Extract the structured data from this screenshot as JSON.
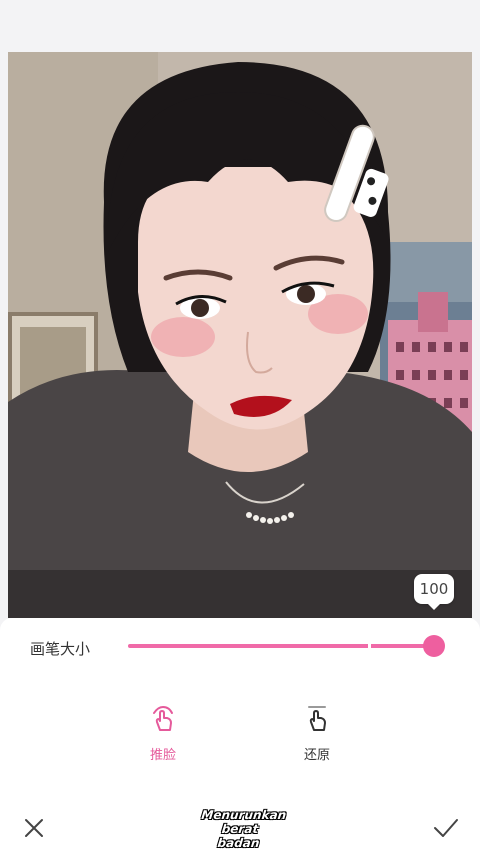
{
  "photo": {
    "brush_size_value": "100"
  },
  "brush": {
    "label": "画笔大小",
    "value": 100,
    "max": 100
  },
  "tools": {
    "push": {
      "label": "推脸",
      "icon": "hand-tap-icon",
      "active": true
    },
    "restore": {
      "label": "还原",
      "icon": "hand-restore-icon",
      "active": false
    }
  },
  "bottom": {
    "cancel_icon": "close-icon",
    "confirm_icon": "checkmark-icon",
    "watermark_line1": "Menurunkan",
    "watermark_line2": "berat badan"
  },
  "colors": {
    "accent": "#ee5f9f",
    "background": "#f3f3f5"
  }
}
